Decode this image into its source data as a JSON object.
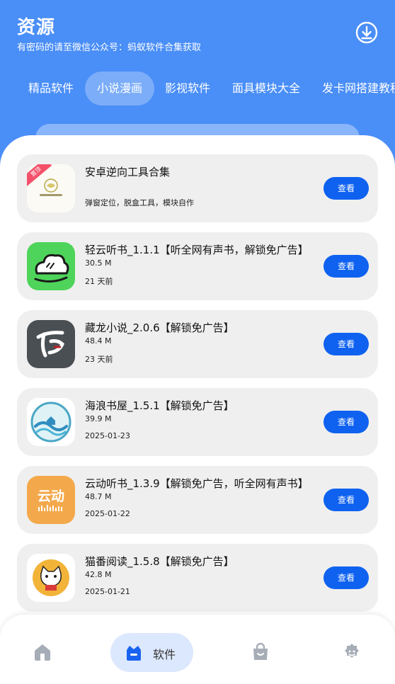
{
  "header": {
    "title": "资源",
    "subtitle": "有密码的请至微信公众号：蚂蚁软件合集获取",
    "download_icon": "download-circle-icon"
  },
  "tabs": [
    {
      "label": "精品软件"
    },
    {
      "label": "小说漫画",
      "active": true
    },
    {
      "label": "影视软件"
    },
    {
      "label": "面具模块大全"
    },
    {
      "label": "发卡网搭建教程"
    }
  ],
  "items": [
    {
      "name": "安卓逆向工具合集",
      "desc": "弹窗定位，脱盒工具，模块自作",
      "badge": "置顶",
      "action": "查看",
      "icon": "toolbox-logo-icon"
    },
    {
      "name": "轻云听书_1.1.1【听全网有声书，解锁免广告】",
      "size": "30.5 M",
      "date": "21 天前",
      "action": "查看",
      "icon": "cloud-audiobook-icon"
    },
    {
      "name": "藏龙小说_2.0.6【解锁免广告】",
      "size": "48.4 M",
      "date": "23 天前",
      "action": "查看",
      "icon": "canglong-novel-icon"
    },
    {
      "name": "海浪书屋_1.5.1【解锁免广告】",
      "size": "39.9 M",
      "date": "2025-01-23",
      "action": "查看",
      "icon": "wave-bookhouse-icon"
    },
    {
      "name": "云动听书_1.3.9【解锁免广告，听全网有声书】",
      "size": "48.7 M",
      "date": "2025-01-22",
      "action": "查看",
      "icon": "yundong-audiobook-icon",
      "icon_text": "云动"
    },
    {
      "name": "猫番阅读_1.5.8【解锁免广告】",
      "size": "42.8 M",
      "date": "2025-01-21",
      "action": "查看",
      "icon": "cat-reader-icon"
    }
  ],
  "bottom_nav": [
    {
      "icon": "home-icon"
    },
    {
      "icon": "software-bag-icon",
      "label": "软件",
      "active": true
    },
    {
      "icon": "shopping-bag-icon"
    },
    {
      "icon": "profile-icon"
    }
  ],
  "colors": {
    "header_bg": "#4a8ef7",
    "button_bg": "#0f62f0",
    "card_bg": "#efefef",
    "nav_active_bg": "#dce8fd",
    "badge_bg": "#f4506a"
  }
}
